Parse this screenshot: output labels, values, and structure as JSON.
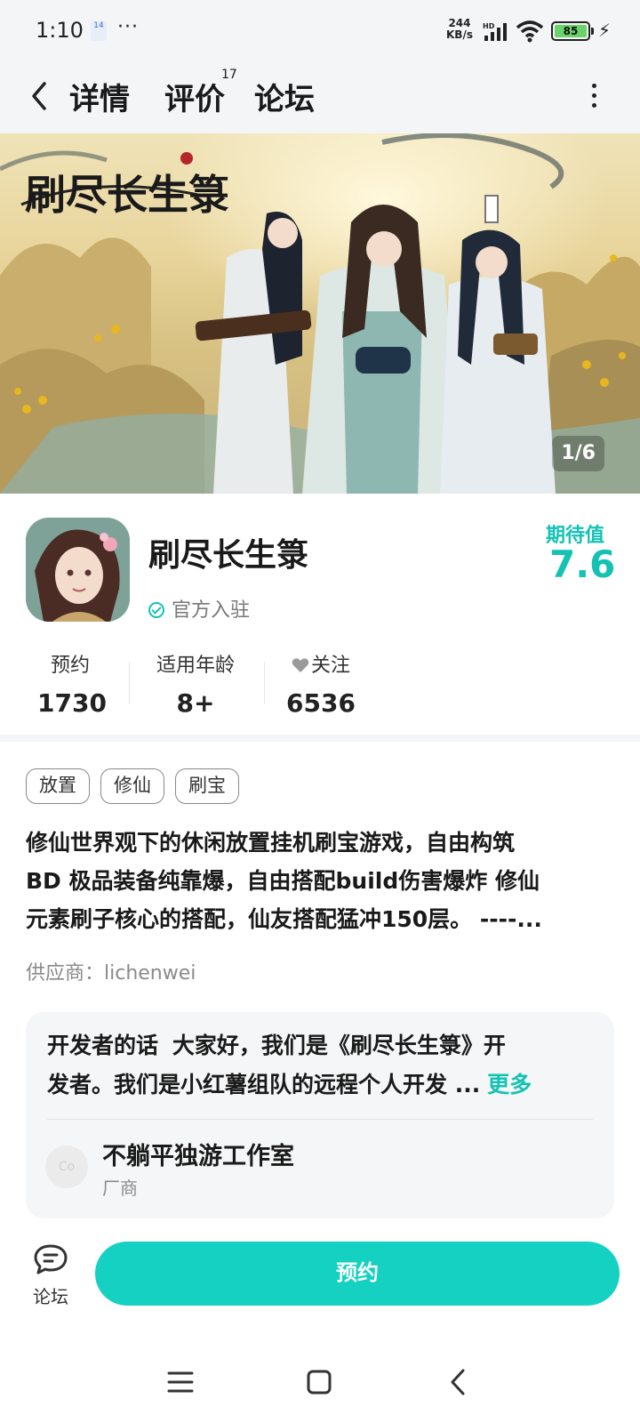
{
  "status_bar": {
    "time": "1:10",
    "notification_badge": "14",
    "more": "···",
    "net_speed_value": "244",
    "net_speed_unit": "KB/s",
    "signal_label": "HD",
    "battery": "85"
  },
  "nav": {
    "tabs": [
      {
        "label": "详情",
        "active": true
      },
      {
        "label": "评价",
        "count": "17"
      },
      {
        "label": "论坛"
      }
    ]
  },
  "banner": {
    "counter": "1/6",
    "logo_text": "刷尽长生箓"
  },
  "game": {
    "title": "刷尽长生箓",
    "official_label": "官方入驻",
    "expect_label": "期待值",
    "expect_value": "7.6"
  },
  "stats": [
    {
      "label": "预约",
      "value": "1730"
    },
    {
      "label": "适用年龄",
      "value": "8+"
    },
    {
      "label": "关注",
      "value": "6536"
    }
  ],
  "tags": [
    "放置",
    "修仙",
    "刷宝"
  ],
  "description_lines": [
    "修仙世界观下的休闲放置挂机刷宝游戏，自由构筑",
    "BD 极品装备纯靠爆，自由搭配build伤害爆炸 修仙",
    "元素刷子核心的搭配，仙友搭配猛冲150层。 ----..."
  ],
  "supplier": "供应商：lichenwei",
  "developer": {
    "heading": "开发者的话",
    "line1": "大家好，我们是《刷尽长生箓》开",
    "line2": "发者。我们是小红薯组队的远程个人开发 ...",
    "more_label": "更多",
    "studio_name": "不躺平独游工作室",
    "studio_role": "厂商",
    "avatar_text": "Co"
  },
  "bottom": {
    "forum_label": "论坛",
    "reserve_label": "预约"
  },
  "colors": {
    "accent": "#14d1c2",
    "accent_text": "#14c2b4"
  }
}
